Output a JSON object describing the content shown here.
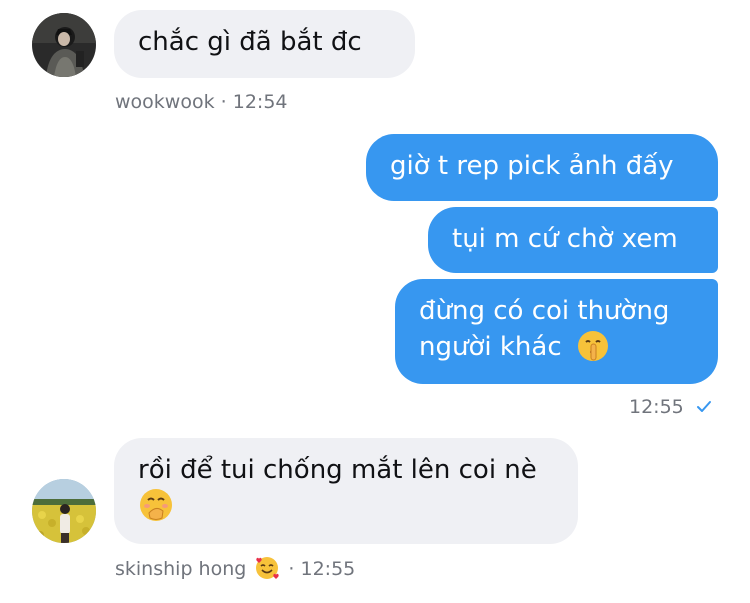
{
  "messages": [
    {
      "side": "in",
      "text": "chắc gì đã bắt đc"
    },
    {
      "side": "out",
      "text": "giờ t rep pick ảnh đấy"
    },
    {
      "side": "out",
      "text": "tụi m cứ chờ xem"
    },
    {
      "side": "out",
      "line1": "đừng có coi thường",
      "line2": "người khác",
      "emoji": "shushing-face"
    },
    {
      "side": "in",
      "text": "rồi để tui chống mắt lên coi nè",
      "emoji": "face-with-hand-over-mouth"
    }
  ],
  "meta": {
    "first_sender": "wookwook",
    "first_time": "12:54",
    "sent_time": "12:55",
    "second_sender": "skinship hong",
    "second_sender_emoji": "smiling-face-with-hearts",
    "second_time": "12:55",
    "separator": "·"
  },
  "colors": {
    "outgoing": "#3797f0",
    "incoming": "#eff0f4",
    "meta": "#70747c",
    "check": "#3797f0"
  }
}
